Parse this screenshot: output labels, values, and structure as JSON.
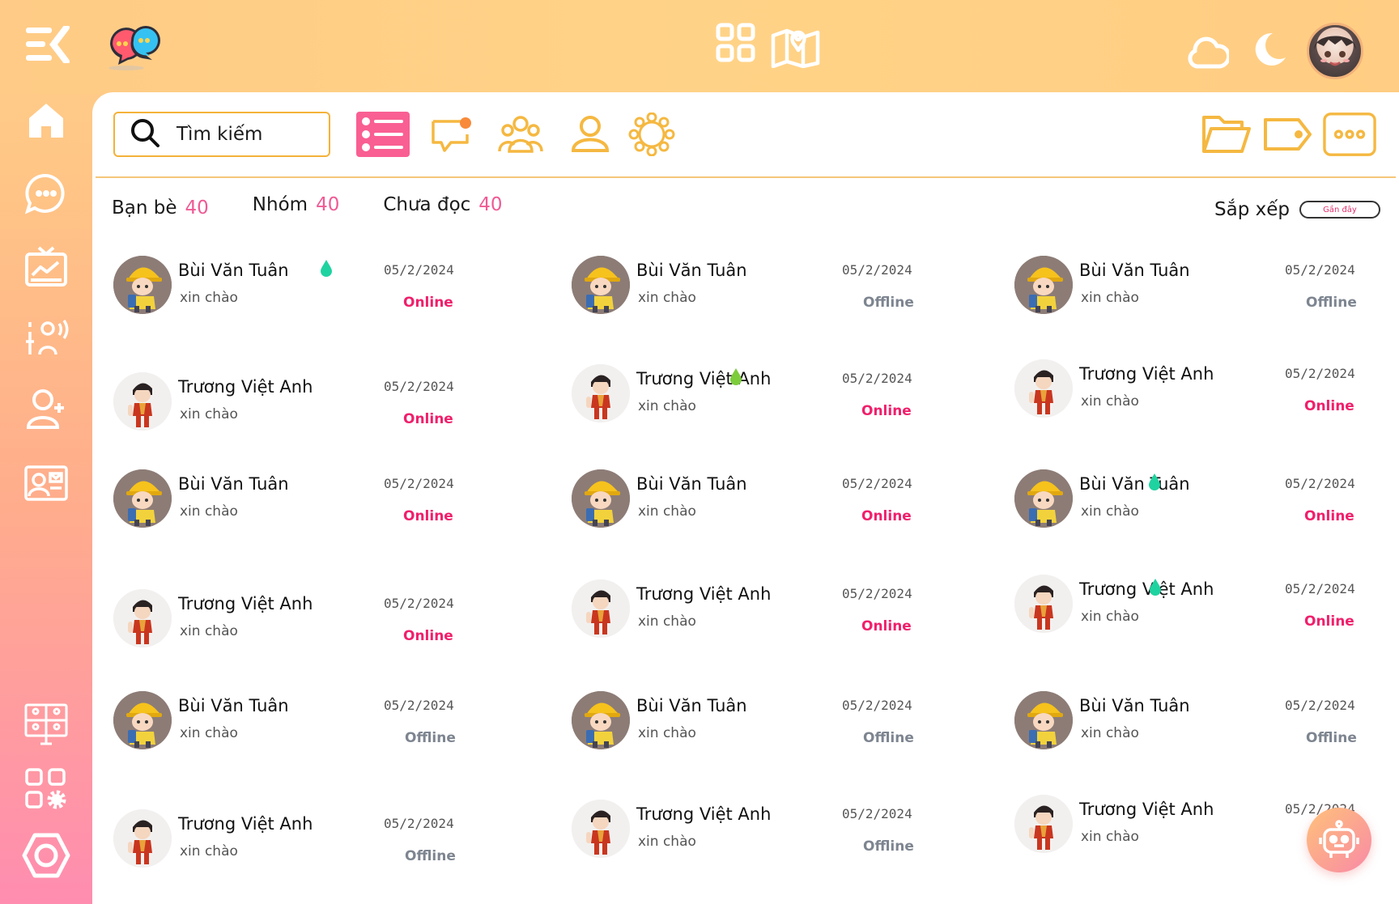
{
  "header": {
    "icons": [
      "menu-icon",
      "chat-bubbles-logo-icon",
      "grid-icon",
      "map-icon",
      "cloud-icon",
      "moon-icon",
      "avatar"
    ]
  },
  "sidebar": {
    "items": [
      "home-icon",
      "chat-icon",
      "tv-analytics-icon",
      "voice-settings-icon",
      "add-user-icon",
      "contact-card-icon",
      "video-conference-icon",
      "apps-settings-icon",
      "hexagon-icon"
    ]
  },
  "search": {
    "placeholder": "Tìm kiếm"
  },
  "toolbar": {
    "icons": [
      "list-icon",
      "notification-chat-icon",
      "group-icon",
      "user-icon",
      "network-icon",
      "folder-icon",
      "tag-icon",
      "more-icon"
    ]
  },
  "filters": [
    {
      "label": "Bạn bè",
      "count": "40"
    },
    {
      "label": "Nhóm",
      "count": "40"
    },
    {
      "label": "Chưa đọc",
      "count": "40"
    }
  ],
  "sort": {
    "label": "Sắp xếp",
    "value": "Gần đây"
  },
  "contacts": [
    {
      "name": "Bùi Văn Tuân",
      "message": "xin chào",
      "date": "05/2/2024",
      "status": "Online",
      "avatar": "bui",
      "drop": "teal"
    },
    {
      "name": "Bùi Văn Tuân",
      "message": "xin chào",
      "date": "05/2/2024",
      "status": "Offline",
      "avatar": "bui",
      "drop": ""
    },
    {
      "name": "Bùi Văn Tuân",
      "message": "xin chào",
      "date": "05/2/2024",
      "status": "Offline",
      "avatar": "bui",
      "drop": ""
    },
    {
      "name": "Trương Việt Anh",
      "message": "xin chào",
      "date": "05/2/2024",
      "status": "Online",
      "avatar": "truong",
      "drop": ""
    },
    {
      "name": "Trương Việt Anh",
      "message": "xin chào",
      "date": "05/2/2024",
      "status": "Online",
      "avatar": "truong",
      "drop": "green"
    },
    {
      "name": "Trương Việt Anh",
      "message": "xin chào",
      "date": "05/2/2024",
      "status": "Online",
      "avatar": "truong",
      "drop": ""
    },
    {
      "name": "Bùi Văn Tuân",
      "message": "xin chào",
      "date": "05/2/2024",
      "status": "Online",
      "avatar": "bui",
      "drop": ""
    },
    {
      "name": "Bùi Văn Tuân",
      "message": "xin chào",
      "date": "05/2/2024",
      "status": "Online",
      "avatar": "bui",
      "drop": ""
    },
    {
      "name": "Bùi Văn Tuân",
      "message": "xin chào",
      "date": "05/2/2024",
      "status": "Online",
      "avatar": "bui",
      "drop": "teal"
    },
    {
      "name": "Trương Việt Anh",
      "message": "xin chào",
      "date": "05/2/2024",
      "status": "Online",
      "avatar": "truong",
      "drop": ""
    },
    {
      "name": "Trương Việt Anh",
      "message": "xin chào",
      "date": "05/2/2024",
      "status": "Online",
      "avatar": "truong",
      "drop": ""
    },
    {
      "name": "Trương Việt Anh",
      "message": "xin chào",
      "date": "05/2/2024",
      "status": "Online",
      "avatar": "truong",
      "drop": "teal"
    },
    {
      "name": "Bùi Văn Tuân",
      "message": "xin chào",
      "date": "05/2/2024",
      "status": "Offline",
      "avatar": "bui",
      "drop": ""
    },
    {
      "name": "Bùi Văn Tuân",
      "message": "xin chào",
      "date": "05/2/2024",
      "status": "Offline",
      "avatar": "bui",
      "drop": ""
    },
    {
      "name": "Bùi Văn Tuân",
      "message": "xin chào",
      "date": "05/2/2024",
      "status": "Offline",
      "avatar": "bui",
      "drop": ""
    },
    {
      "name": "Trương Việt Anh",
      "message": "xin chào",
      "date": "05/2/2024",
      "status": "Offline",
      "avatar": "truong",
      "drop": ""
    },
    {
      "name": "Trương Việt Anh",
      "message": "xin chào",
      "date": "05/2/2024",
      "status": "Offline",
      "avatar": "truong",
      "drop": ""
    },
    {
      "name": "Trương Việt Anh",
      "message": "xin chào",
      "date": "05/2/2024",
      "status": "",
      "avatar": "truong",
      "drop": ""
    }
  ],
  "colors": {
    "accent": "#f4b23a",
    "pink": "#ef5a95",
    "online": "#f01f6b",
    "offline": "#7d8590",
    "drop_teal": "#1fd3a0",
    "drop_green": "#7dcc3c"
  },
  "assistant": {
    "icon": "robot-icon"
  }
}
